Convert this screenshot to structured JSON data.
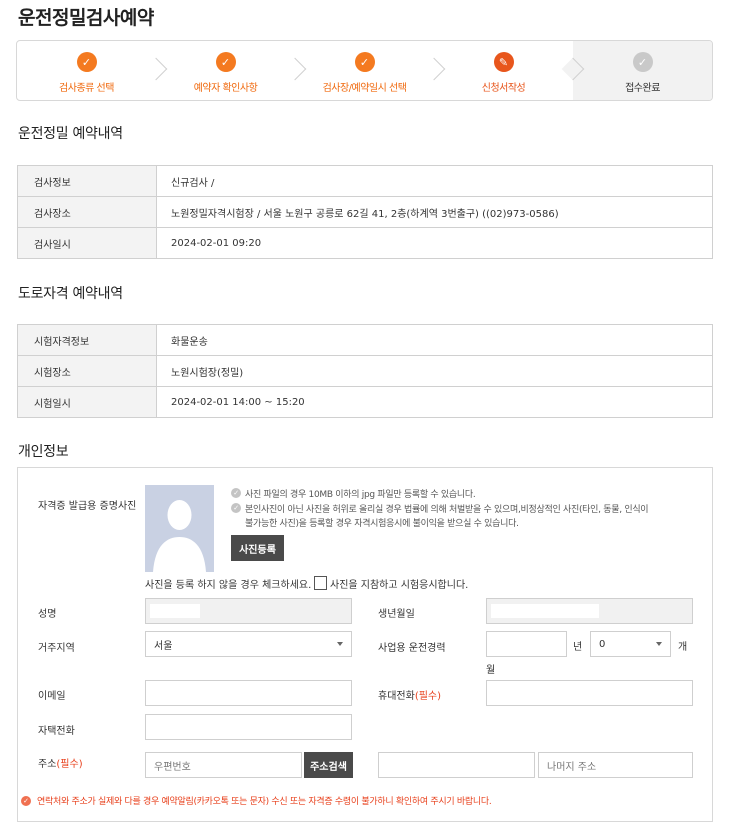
{
  "page": {
    "title": "운전정밀검사예약"
  },
  "stepper": {
    "steps": [
      {
        "label": "검사종류 선택",
        "state": "done"
      },
      {
        "label": "예약자 확인사항",
        "state": "done"
      },
      {
        "label": "검사장/예약일시 선택",
        "state": "done"
      },
      {
        "label": "신청서작성",
        "state": "current"
      },
      {
        "label": "접수완료",
        "state": "pending"
      }
    ]
  },
  "precision_section": {
    "title": "운전정밀 예약내역",
    "rows": [
      {
        "label": "검사정보",
        "value": "신규검사 /"
      },
      {
        "label": "검사장소",
        "value": "노원정밀자격시험장 / 서울 노원구 공릉로 62길 41, 2층(하계역 3번출구) ((02)973-0586)"
      },
      {
        "label": "검사일시",
        "value": "2024-02-01 09:20"
      }
    ]
  },
  "road_section": {
    "title": "도로자격 예약내역",
    "rows": [
      {
        "label": "시험자격정보",
        "value": "화물운송"
      },
      {
        "label": "시험장소",
        "value": "노원시험장(정밀)"
      },
      {
        "label": "시험일시",
        "value": "2024-02-01 14:00 ~ 15:20"
      }
    ]
  },
  "personal": {
    "title": "개인정보",
    "photo_label": "자격증 발급용 증명사진",
    "photo_notes": [
      "사진 파일의 경우 10MB 이하의 jpg 파일만 등록할 수 있습니다.",
      "본인사진이 아닌 사진을 허위로 올리실 경우 법률에 의해 처벌받을 수 있으며,비정상적인 사진(타인, 동물, 인식이",
      "불가능한 사진)을 등록할 경우 자격시험응시에 불이익을 받으실 수 있습니다."
    ],
    "photo_button": "사진등록",
    "photo_check_text": "사진을 등록 하지 않을 경우 체크하세요.",
    "photo_check_label": "사진을 지참하고 시험응시합니다.",
    "name_label": "성명",
    "birth_label": "생년월일",
    "region_label": "거주지역",
    "region_value": "서울",
    "career_label": "사업용 운전경력",
    "career_year_unit": "년",
    "career_month_value": "0",
    "career_month_unit_1": "개",
    "career_month_unit_2": "월",
    "email_label": "이메일",
    "mobile_label": "휴대전화",
    "required_text": "(필수)",
    "home_phone_label": "자택전화",
    "address_label": "주소",
    "zip_placeholder": "우편번호",
    "address_search_button": "주소검색",
    "address_rest_placeholder": "나머지 주소",
    "warning": "연락처와 주소가 실제와 다를 경우 예약알림(카카오톡 또는 문자) 수신 또는 자격증 수령이 불가하니 확인하여 주시기 바랍니다."
  },
  "colors": {
    "accent": "#f47a20",
    "current": "#e8561c",
    "required": "#e8401c"
  }
}
